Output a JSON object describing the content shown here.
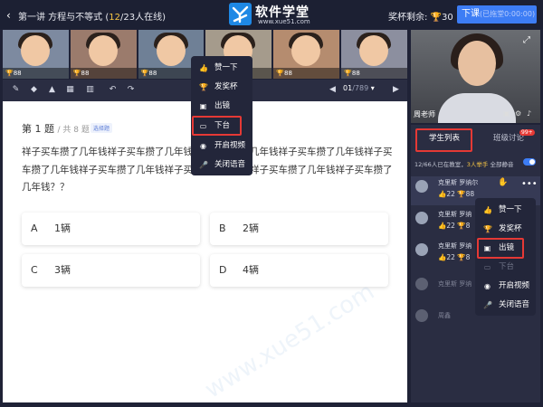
{
  "topbar": {
    "lesson_prefix": "第一讲 方程与不等式 (",
    "lesson_online": "12",
    "lesson_suffix": "/23人在线)",
    "site_title": "软件学堂",
    "site_url": "www.xue51.com",
    "cups_label": "奖杯剩余:",
    "cups_count": "30",
    "end_class": "下课",
    "end_time": "(已拖堂0:00:00)"
  },
  "students": [
    {
      "cups": "88"
    },
    {
      "cups": "88"
    },
    {
      "cups": "88"
    },
    {
      "cups": "88"
    },
    {
      "cups": "88"
    },
    {
      "cups": "88"
    }
  ],
  "toolbar": {
    "page": "01",
    "page_total": "/789"
  },
  "question": {
    "title": "第 1 题",
    "count": "/ 共 8 题",
    "type_tag": "选择题",
    "text": "祥子买车攒了几年钱祥子买车攒了几年钱祥子买车攒了几年钱祥子买车攒了几年钱祥子买车攒了几年钱祥子买车攒了几年钱祥子买车攒了几年钱祥子买车攒了几年钱祥子买车攒了几年钱？？",
    "options": [
      {
        "key": "A",
        "value": "1辆"
      },
      {
        "key": "B",
        "value": "2辆"
      },
      {
        "key": "C",
        "value": "3辆"
      },
      {
        "key": "D",
        "value": "4辆"
      }
    ]
  },
  "menu1": {
    "items": [
      {
        "label": "赞一下",
        "icon": "thumbs-up-icon"
      },
      {
        "label": "发奖杯",
        "icon": "trophy-icon"
      },
      {
        "label": "出镜",
        "icon": "camera-on-icon"
      },
      {
        "label": "下台",
        "icon": "stage-down-icon"
      },
      {
        "label": "开启视频",
        "icon": "video-icon"
      },
      {
        "label": "关闭语音",
        "icon": "mic-icon"
      }
    ]
  },
  "teacher": {
    "name": "周老师"
  },
  "panel": {
    "tab_students": "学生列表",
    "tab_group": "班级讨论",
    "group_badge": "99+",
    "online_prefix": "12/66人已在教室，",
    "online_hands": "3人举手",
    "mute_all": "全部静音",
    "rows": [
      {
        "name": "克里斯 罗纳尔",
        "likes": "22",
        "cups": "88"
      },
      {
        "name": "克里斯 罗纳",
        "likes": "22",
        "cups": "8"
      },
      {
        "name": "克里斯 罗纳",
        "likes": "22",
        "cups": "8"
      },
      {
        "name": "克里斯 罗纳",
        "likes": "",
        "cups": ""
      },
      {
        "name": "周鑫",
        "likes": "",
        "cups": ""
      }
    ]
  },
  "menu2": {
    "items": [
      {
        "label": "赞一下",
        "icon": "thumbs-up-icon"
      },
      {
        "label": "发奖杯",
        "icon": "trophy-icon"
      },
      {
        "label": "出镜",
        "icon": "camera-on-icon"
      },
      {
        "label": "下台",
        "icon": "stage-down-icon"
      },
      {
        "label": "开启视频",
        "icon": "video-icon"
      },
      {
        "label": "关闭语音",
        "icon": "mic-icon"
      }
    ]
  },
  "colors": {
    "accent": "#3d7df5",
    "highlight": "#e53935",
    "gold": "#f6c544"
  }
}
